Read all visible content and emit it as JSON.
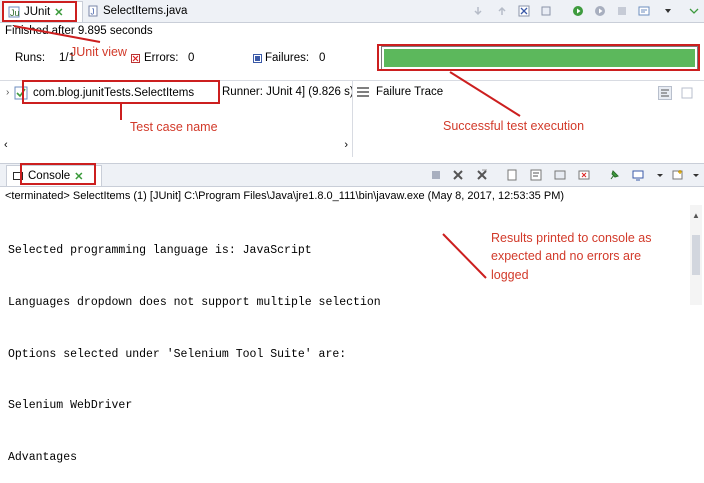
{
  "tabs": {
    "junit": "JUnit",
    "select_items": "SelectItems.java"
  },
  "status": {
    "finished": "Finished after 9.895 seconds"
  },
  "counters": {
    "runs_label": "Runs:",
    "runs_value": "1/1",
    "errors_label": "Errors:",
    "errors_value": "0",
    "failures_label": "Failures:",
    "failures_value": "0"
  },
  "progress": {
    "fraction": 1.0,
    "color": "#5cb85c"
  },
  "tree": {
    "test_class": "com.blog.junitTests.SelectItems",
    "runner": "Runner: JUnit 4] (9.826 s)"
  },
  "failure_trace": "Failure Trace",
  "console": {
    "tab": "Console",
    "terminated": "<terminated> SelectItems (1) [JUnit] C:\\Program Files\\Java\\jre1.8.0_111\\bin\\javaw.exe (May 8, 2017, 12:53:35 PM)",
    "lines": [
      "Selected programming language is: JavaScript",
      "Languages dropdown does not support multiple selection",
      "Options selected under 'Selenium Tool Suite' are:",
      "Selenium WebDriver",
      "Advantages"
    ]
  },
  "annotations": {
    "junit_view": "JUnit view",
    "test_case_name": "Test case name",
    "successful": "Successful test execution",
    "results_line1": "Results printed to console as",
    "results_line2": "expected and no errors are",
    "results_line3": "logged"
  },
  "colors": {
    "annotation": "#cc1f1f",
    "success_bar": "#5cb85c",
    "chrome": "#eef1f6"
  },
  "icons": [
    "junit-icon",
    "java-file-icon",
    "close-icon",
    "error-icon",
    "failure-icon",
    "test-class-icon",
    "failure-trace-icon",
    "console-icon",
    "terminate-icon",
    "remove-icon",
    "pin-icon",
    "minimize-icon",
    "maximize-icon"
  ]
}
